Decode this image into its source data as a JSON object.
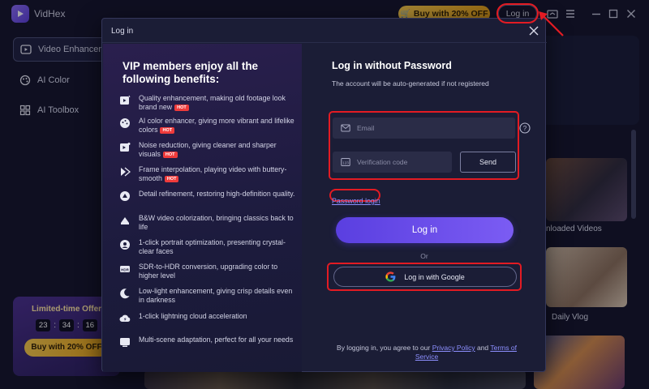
{
  "app": {
    "name": "VidHex",
    "promo_label": "Buy with 20% OFF",
    "login_label": "Log in",
    "accent": "#7b5cf3",
    "highlight_color": "#e31b23"
  },
  "sidebar": {
    "items": [
      {
        "label": "Video Enhancer",
        "icon": "video-enhancer-icon"
      },
      {
        "label": "AI Color",
        "icon": "palette-icon"
      },
      {
        "label": "AI Toolbox",
        "icon": "toolbox-icon"
      }
    ],
    "offer": {
      "title": "Limited-time Offer",
      "timer": {
        "hours": "23",
        "minutes": "34",
        "seconds": "16"
      },
      "button": "Buy with 20% OFF"
    }
  },
  "cards": {
    "labels": [
      "nloaded Videos",
      "Daily Vlog"
    ]
  },
  "modal": {
    "title": "Log in",
    "benefits_title": "VIP members enjoy all the following benefits:",
    "benefits": [
      {
        "text": "Quality enhancement, making old footage look brand new",
        "hot": "HOT"
      },
      {
        "text": "AI color enhancer, giving more vibrant and lifelike colors",
        "hot": "HOT"
      },
      {
        "text": "Noise reduction, giving cleaner and sharper visuals",
        "hot": "HOT"
      },
      {
        "text": "Frame interpolation, playing video with buttery-smooth",
        "hot": "HOT"
      },
      {
        "text": "Detail refinement, restoring high-definition quality.",
        "hot": null
      },
      {
        "text": "B&W video colorization, bringing classics back to life",
        "hot": null
      },
      {
        "text": "1-click portrait optimization, presenting crystal-clear faces",
        "hot": null
      },
      {
        "text": "SDR-to-HDR conversion, upgrading color to higher level",
        "hot": null
      },
      {
        "text": "Low-light enhancement, giving crisp details even in darkness",
        "hot": null
      },
      {
        "text": "1-click lightning cloud acceleration",
        "hot": null
      },
      {
        "text": "Multi-scene adaptation, perfect for all your needs",
        "hot": null
      }
    ],
    "form": {
      "title": "Log in without Password",
      "subtitle": "The account will be auto-generated if not registered",
      "email_placeholder": "Email",
      "code_placeholder": "Verification code",
      "send_label": "Send",
      "password_login": "Password login",
      "login_button": "Log in",
      "or_label": "Or",
      "google_label": "Log in with Google",
      "terms_prefix": "By logging in, you agree to our ",
      "privacy_label": "Privacy Policy",
      "terms_and": " and ",
      "terms_label": "Terms of Service"
    }
  }
}
